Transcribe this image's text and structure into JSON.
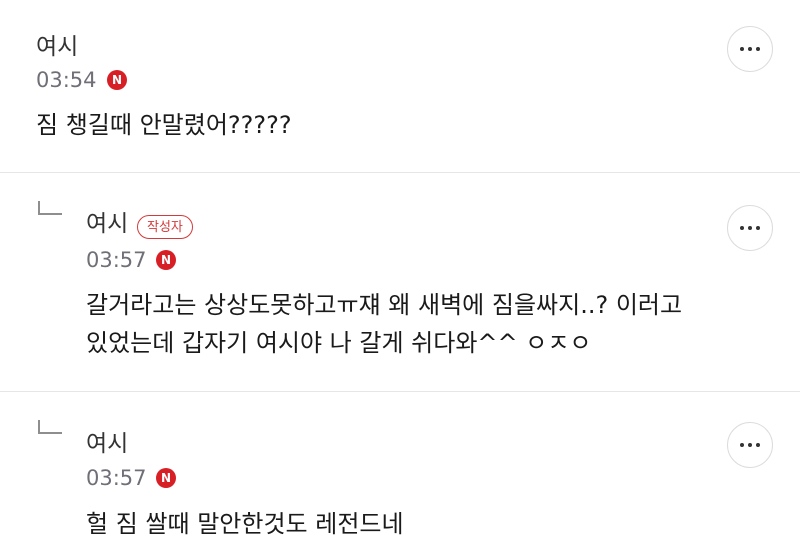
{
  "comments": [
    {
      "author": "여시",
      "time": "03:54",
      "new_badge": "N",
      "text_lines": [
        "짐 챙길때 안말렸어?????"
      ]
    },
    {
      "author": "여시",
      "author_badge": "작성자",
      "time": "03:57",
      "new_badge": "N",
      "text_lines": [
        "갈거라고는 상상도못하고ㅠ쟤 왜 새벽에 짐을싸지..? 이러고",
        "있었는데 갑자기 여시야 나 갈게 쉬다와^^ ㅇㅈㅇ"
      ]
    },
    {
      "author": "여시",
      "time": "03:57",
      "new_badge": "N",
      "text_lines": [
        "헐 짐 쌀때 말안한것도 레전드네"
      ]
    }
  ],
  "icons": {
    "more": "more-horizontal-icon",
    "reply": "reply-arrow-icon"
  },
  "colors": {
    "new_badge": "#d71f26",
    "author_badge": "#d23b3b",
    "time": "#6f6f78",
    "divider": "#e6e6e6"
  }
}
